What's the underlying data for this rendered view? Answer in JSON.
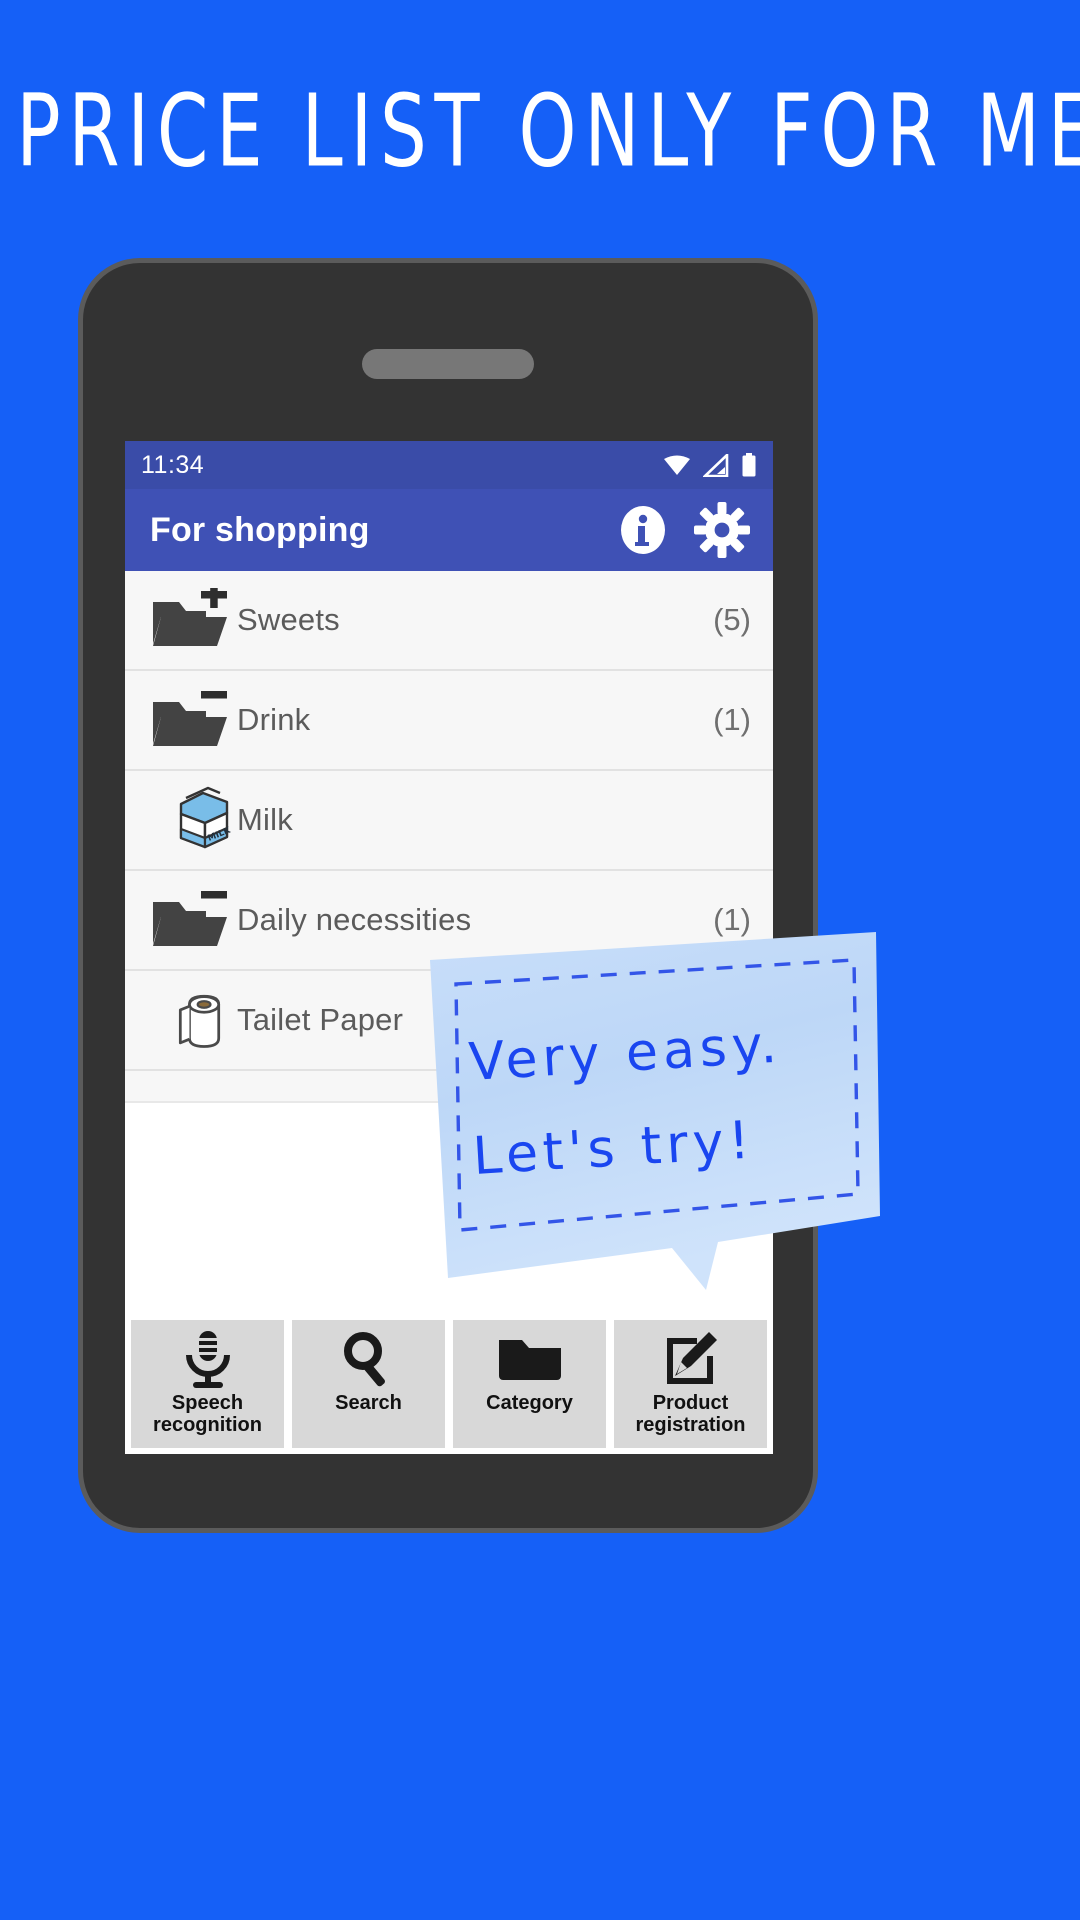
{
  "headline": "PRICE LIST ONLY FOR ME",
  "colors": {
    "background": "#1560f7",
    "appbar": "#3f51b5",
    "statusbar": "#3a4ca8",
    "bubble_fill": "#bcd6f5",
    "bubble_border": "#3355e8",
    "bubble_text": "#1a46f0",
    "toolbar_button": "#d8d8d8",
    "row_background": "#f7f7f7",
    "row_text": "#5b5b5b",
    "milk_blue": "#79bde8"
  },
  "phone": {
    "status_bar": {
      "time": "11:34",
      "icons": [
        "wifi-icon",
        "signal-icon",
        "battery-icon"
      ]
    },
    "app_bar": {
      "title": "For shopping",
      "actions": [
        {
          "name": "info-icon",
          "label": "Info"
        },
        {
          "name": "gear-icon",
          "label": "Settings"
        }
      ]
    },
    "list": [
      {
        "icon": "folder-plus-icon",
        "label": "Sweets",
        "count": "(5)",
        "type": "category"
      },
      {
        "icon": "folder-minus-icon",
        "label": "Drink",
        "count": "(1)",
        "type": "category"
      },
      {
        "icon": "milk-carton-icon",
        "label": "Milk",
        "count": "",
        "type": "product"
      },
      {
        "icon": "folder-minus-icon",
        "label": "Daily necessities",
        "count": "(1)",
        "type": "category"
      },
      {
        "icon": "toilet-paper-icon",
        "label": "Tailet Paper",
        "count": "",
        "type": "product"
      }
    ],
    "toolbar": [
      {
        "icon": "microphone-icon",
        "label": "Speech\nrecognition"
      },
      {
        "icon": "search-icon",
        "label": "Search"
      },
      {
        "icon": "folder-icon",
        "label": "Category"
      },
      {
        "icon": "edit-square-icon",
        "label": "Product\nregistration"
      }
    ]
  },
  "callout": {
    "line1": "Very easy.",
    "line2": "Let's try!"
  }
}
